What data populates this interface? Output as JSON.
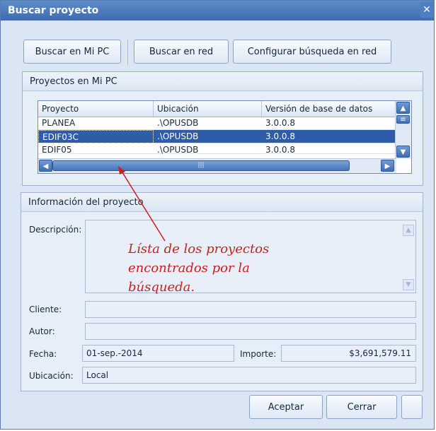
{
  "window": {
    "title": "Buscar proyecto",
    "close_symbol": "✕"
  },
  "toolbar": {
    "search_local": "Buscar en Mi PC",
    "search_network": "Buscar en red",
    "configure_network": "Configurar búsqueda en red"
  },
  "projects_group": {
    "title": "Proyectos en Mi PC",
    "columns": [
      "Proyecto",
      "Ubicación",
      "Versión de base de datos"
    ],
    "rows": [
      {
        "project": "PLANEA",
        "location": ".\\OPUSDB",
        "version": "3.0.0.8",
        "selected": false
      },
      {
        "project": "EDIF03C",
        "location": ".\\OPUSDB",
        "version": "3.0.0.8",
        "selected": true
      },
      {
        "project": "EDIF05",
        "location": ".\\OPUSDB",
        "version": "3.0.0.8",
        "selected": false
      }
    ]
  },
  "info_group": {
    "title": "Información del proyecto",
    "description_label": "Descripción:",
    "client_label": "Cliente:",
    "author_label": "Autor:",
    "date_label": "Fecha:",
    "date_value": "01-sep.-2014",
    "amount_label": "Importe:",
    "amount_value": "$3,691,579.11",
    "location_label": "Ubicación:",
    "location_value": "Local"
  },
  "annotation": {
    "line1": "Lísta de los proyectos",
    "line2": "encontrados por la",
    "line3": "búsqueda.",
    "color": "#cc1f1f"
  },
  "buttons": {
    "accept": "Aceptar",
    "close": "Cerrar"
  },
  "colors": {
    "title_bar": "#3e6db0",
    "selection": "#2e5ca8"
  }
}
